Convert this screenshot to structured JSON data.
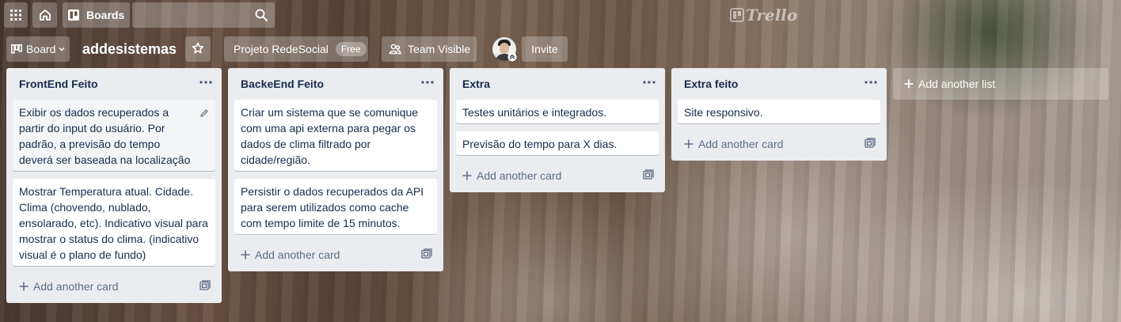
{
  "header": {
    "boards_label": "Boards",
    "search_placeholder": "",
    "logo_text": "Trello"
  },
  "board": {
    "switcher_label": "Board",
    "title": "addesistemas",
    "team_name": "Projeto RedeSocial",
    "team_badge": "Free",
    "visibility_label": "Team Visible",
    "invite_label": "Invite"
  },
  "lists": [
    {
      "title": "FrontEnd Feito",
      "cards": [
        "Exibir os dados recuperados a partir do input do usuário. Por padrão, a previsão do tempo deverá ser baseada na localização atual do usuário.",
        "Mostrar Temperatura atual. Cidade. Clima (chovendo, nublado, ensolarado, etc). Indicativo visual para mostrar o status do clima. (indicativo visual é o plano de fundo)"
      ],
      "add_card_label": "Add another card"
    },
    {
      "title": "BackeEnd Feito",
      "cards": [
        "Criar um sistema que se comunique com uma api externa para pegar os dados de clima filtrado por cidade/região.",
        "Persistir o dados recuperados da API para serem utilizados como cache com tempo limite de 15 minutos."
      ],
      "add_card_label": "Add another card"
    },
    {
      "title": "Extra",
      "cards": [
        "Testes unitários e integrados.",
        "Previsão do tempo para X dias."
      ],
      "add_card_label": "Add another card"
    },
    {
      "title": "Extra feito",
      "cards": [
        "Site responsivo."
      ],
      "add_card_label": "Add another card"
    }
  ],
  "add_list_label": "Add another list",
  "colors": {
    "list_bg": "#ebecf0",
    "card_text": "#172b4d",
    "muted_text": "#5e6c84"
  }
}
